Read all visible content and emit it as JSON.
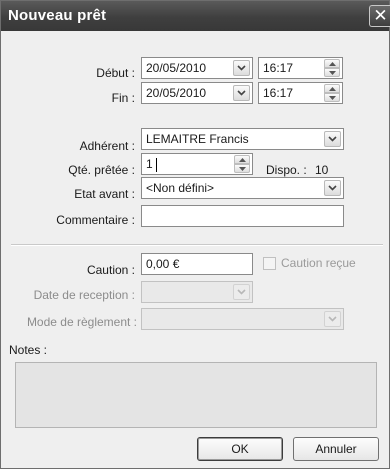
{
  "window": {
    "title": "Nouveau prêt",
    "close_glyph": "✕"
  },
  "debut": {
    "label": "Début :",
    "date": "20/05/2010",
    "time": "16:17"
  },
  "fin": {
    "label": "Fin :",
    "date": "20/05/2010",
    "time": "16:17"
  },
  "adherent": {
    "label": "Adhérent :",
    "value": "LEMAITRE Francis"
  },
  "qte": {
    "label": "Qté. prêtée :",
    "value": "1",
    "dispo_label": "Dispo. :",
    "dispo_value": "10"
  },
  "etat": {
    "label": "Etat avant :",
    "value": "<Non défini>"
  },
  "commentaire": {
    "label": "Commentaire :",
    "value": ""
  },
  "caution": {
    "label": "Caution :",
    "value": "0,00 €",
    "checkbox_label": "Caution reçue",
    "checked": false
  },
  "reception": {
    "label": "Date de reception :",
    "value": ""
  },
  "reglement": {
    "label": "Mode de règlement :",
    "value": ""
  },
  "notes": {
    "label": "Notes :",
    "value": ""
  },
  "buttons": {
    "ok": "OK",
    "cancel": "Annuler"
  },
  "icons": {
    "dropdown": "chevron-down-icon",
    "spinner_up": "triangle-up-icon",
    "spinner_down": "triangle-down-icon",
    "close": "close-icon"
  },
  "colors": {
    "titlebar": "#454545",
    "dialog_bg": "#efefef",
    "field_bg": "#ffffff",
    "disabled_field_bg": "#e9e9e9",
    "notes_bg": "#e4e4e4"
  }
}
